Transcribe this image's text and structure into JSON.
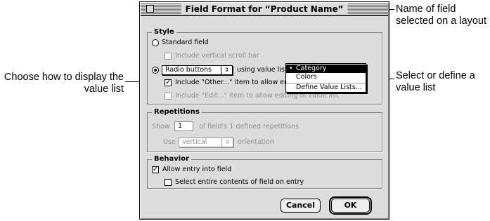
{
  "dialog": {
    "title": "Field Format for “Product Name”"
  },
  "callouts": {
    "field_name": "Name of field selected on a layout",
    "display_value_list": "Choose how to display the value list",
    "select_value_list": "Select or define a value list"
  },
  "style": {
    "group_label": "Style",
    "standard_field": "Standard field",
    "vertical_scroll": "Include vertical scroll bar",
    "display_as": "Radio buttons",
    "using_value_list": "using value list",
    "include_other": "Include \"Other...\" item to allow entr",
    "include_edit": "Include \"Edit...\" item to allow editing of value list",
    "value_list_menu": {
      "items": [
        "Category",
        "Colors",
        "Define Value Lists..."
      ],
      "selected": "Category"
    }
  },
  "repetitions": {
    "group_label": "Repetitions",
    "show_label": "Show",
    "show_value": "1",
    "of_defined": "of field's 1 defined repetitions",
    "use_label": "Use",
    "orientation_value": "vertical",
    "orientation_label": "orientation"
  },
  "behavior": {
    "group_label": "Behavior",
    "allow_entry": "Allow entry into field",
    "select_entire": "Select entire contents of field on entry"
  },
  "buttons": {
    "cancel": "Cancel",
    "ok": "OK"
  },
  "icons": {
    "radio_selected": "radio-on-icon",
    "checkmark": "✓",
    "popup_arrow": "⇕",
    "bullet": "•"
  }
}
